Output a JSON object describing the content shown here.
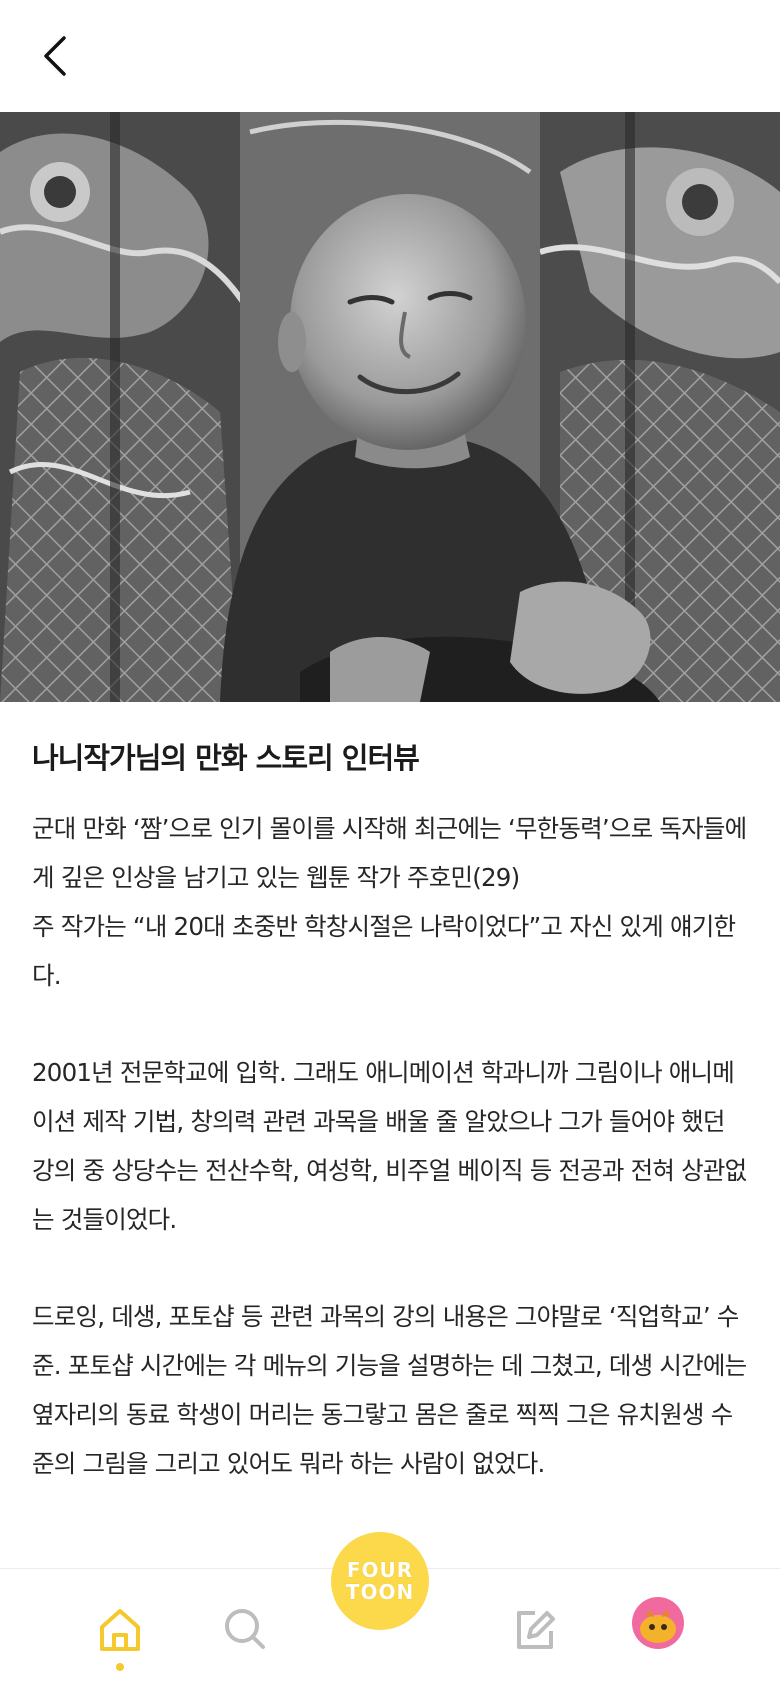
{
  "header": {
    "back_icon": "chevron-left-icon"
  },
  "hero": {
    "alt": ""
  },
  "article": {
    "title": "나니작가님의 만화 스토리 인터뷰",
    "paragraphs": [
      "군대 만화 ‘짬’으로 인기 몰이를 시작해 최근에는 ‘무한동력’으로 독자들에게 깊은 인상을 남기고 있는 웹툰 작가 주호민(29)\n주 작가는 “내 20대 초중반 학창시절은 나락이었다”고 자신 있게 얘기한다.",
      "2001년 전문학교에 입학. 그래도 애니메이션 학과니까 그림이나 애니메이션 제작 기법, 창의력 관련 과목을 배울 줄 알았으나 그가 들어야 했던 강의 중 상당수는 전산수학, 여성학, 비주얼 베이직 등 전공과 전혀 상관없는 것들이었다.",
      "드로잉, 데생, 포토샵 등 관련 과목의 강의 내용은 그야말로 ‘직업학교’ 수준. 포토샵 시간에는 각 메뉴의 기능을 설명하는 데 그쳤고, 데생 시간에는 옆자리의 동료 학생이 머리는 동그랗고 몸은 줄로 찍찍 그은 유치원생 수준의 그림을 그리고 있어도 뭐라 하는 사람이 없었다."
    ]
  },
  "bottom_nav": {
    "items": [
      {
        "name": "home",
        "icon": "home-icon",
        "active": true
      },
      {
        "name": "search",
        "icon": "search-icon",
        "active": false
      },
      {
        "name": "write",
        "icon": "edit-icon",
        "active": false
      },
      {
        "name": "profile",
        "icon": "avatar-icon",
        "active": false
      }
    ],
    "fab": {
      "line1": "FOUR",
      "line2": "TOON"
    },
    "accent_color": "#f5c82e"
  }
}
